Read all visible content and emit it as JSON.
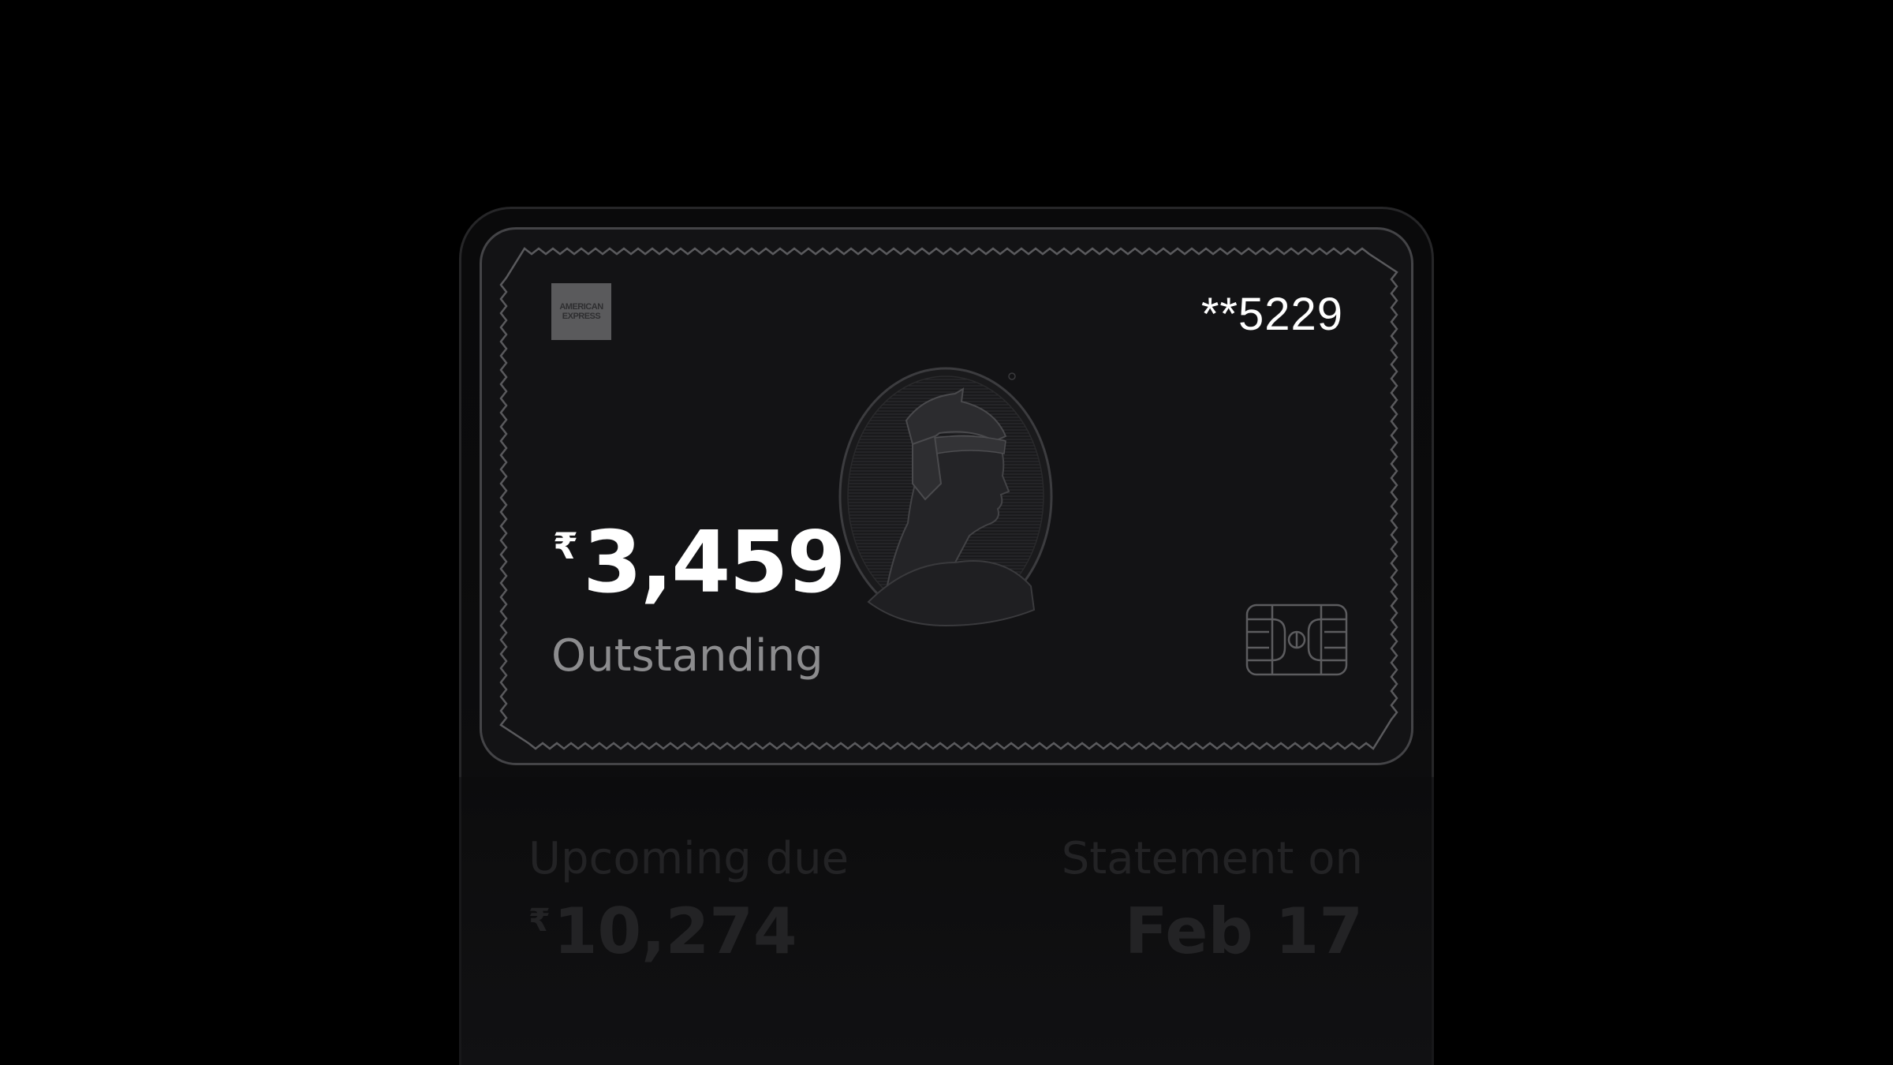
{
  "card": {
    "brand_logo_line1": "AMERICAN",
    "brand_logo_line2": "EXPRESS",
    "masked_number": "**5229",
    "currency_symbol": "₹",
    "outstanding_amount": "3,459",
    "outstanding_label": "Outstanding",
    "portrait_icon": "centurion-portrait-icon",
    "chip_icon": "card-chip-icon"
  },
  "summary": {
    "upcoming_due_label": "Upcoming due",
    "upcoming_due_currency": "₹",
    "upcoming_due_amount": "10,274",
    "statement_label": "Statement on",
    "statement_date": "Feb 17"
  },
  "colors": {
    "background": "#000000",
    "card_fill": "#131315",
    "card_border": "#444447",
    "text_primary": "#ffffff",
    "text_secondary": "#8c8c8e",
    "text_dimmed": "#232325"
  }
}
